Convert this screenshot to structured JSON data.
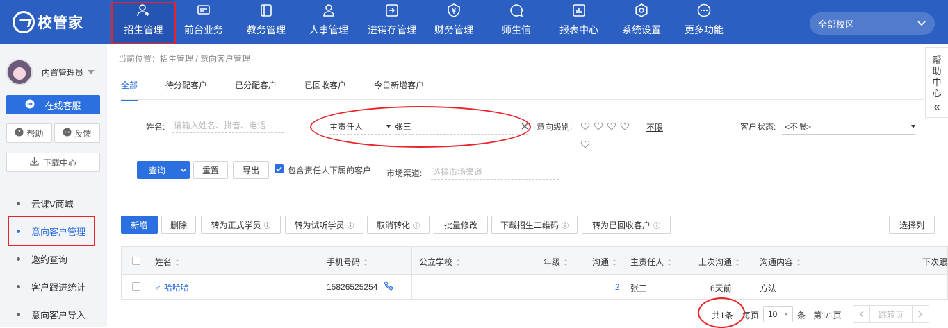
{
  "app": {
    "logo_text": "校管家"
  },
  "nav": [
    {
      "label": "招生管理",
      "icon": "user-add-icon"
    },
    {
      "label": "前台业务",
      "icon": "monitor-icon"
    },
    {
      "label": "教务管理",
      "icon": "book-icon"
    },
    {
      "label": "人事管理",
      "icon": "person-icon"
    },
    {
      "label": "进销存管理",
      "icon": "in-out-icon"
    },
    {
      "label": "财务管理",
      "icon": "yen-shield-icon"
    },
    {
      "label": "师生信",
      "icon": "chat-icon"
    },
    {
      "label": "报表中心",
      "icon": "report-icon"
    },
    {
      "label": "系统设置",
      "icon": "gear-icon"
    },
    {
      "label": "更多功能",
      "icon": "more-icon"
    }
  ],
  "campus_select": {
    "value": "全部校区"
  },
  "sidebar": {
    "username": "内置管理员",
    "online_service": "在线客服",
    "help": "帮助",
    "feedback": "反馈",
    "download": "下载中心",
    "items": [
      {
        "label": "云课V商城"
      },
      {
        "label": "意向客户管理"
      },
      {
        "label": "邀约查询"
      },
      {
        "label": "客户跟进统计"
      },
      {
        "label": "意向客户导入"
      }
    ]
  },
  "breadcrumb": "当前位置：招生管理 / 意向客户管理",
  "tabs": [
    "全部",
    "待分配客户",
    "已分配客户",
    "已回收客户",
    "今日新增客户"
  ],
  "filters": {
    "name_label": "姓名:",
    "name_placeholder": "请输入姓名、拼音、电话",
    "owner_select": "主责任人",
    "owner_value": "张三",
    "intent_label": "意向级别:",
    "intent_unlimited": "不限",
    "status_label": "客户状态:",
    "status_value": "<不限>",
    "query": "查询",
    "reset": "重置",
    "export": "导出",
    "include_sub": "包含责任人下属的客户",
    "channel_label": "市场渠道:",
    "channel_placeholder": "选择市场渠道"
  },
  "toolbar": {
    "add": "新增",
    "delete": "删除",
    "to_formal": "转为正式学员",
    "to_trial": "转为试听学员",
    "cancel_convert": "取消转化",
    "batch_edit": "批量修改",
    "download_qr": "下载招生二维码",
    "to_recycled": "转为已回收客户",
    "select_columns": "选择列"
  },
  "table": {
    "headers": [
      "姓名",
      "手机号码",
      "公立学校",
      "年级",
      "沟通",
      "主责任人",
      "上次沟通",
      "沟通内容",
      "下次跟"
    ],
    "rows": [
      {
        "name": "哈哈哈",
        "phone": "15826525254",
        "school": "",
        "grade": "",
        "comm": "2",
        "owner": "张三",
        "last": "6天前",
        "content": "方法"
      }
    ]
  },
  "pagination": {
    "total": "共1条",
    "per_page_label": "每页",
    "per_page": "10",
    "unit": "条",
    "page": "第1/1页",
    "jump": "跳转页"
  },
  "help_center": [
    "帮",
    "助",
    "中",
    "心"
  ],
  "colors": {
    "topbar": "#2b5fc2",
    "primary": "#2b6fe0",
    "annotation": "#e8242a"
  }
}
